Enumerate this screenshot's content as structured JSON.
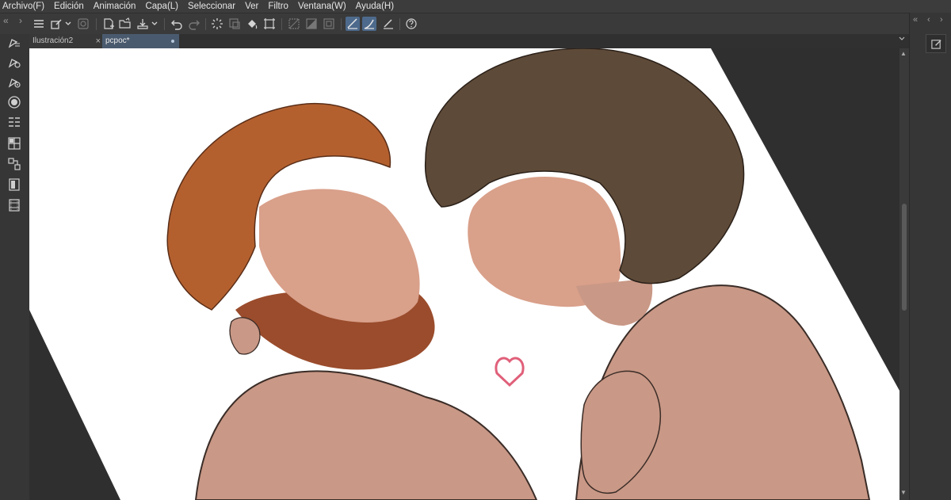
{
  "menu": [
    "Archivo(F)",
    "Edición",
    "Animación",
    "Capa(L)",
    "Seleccionar",
    "Ver",
    "Filtro",
    "Ventana(W)",
    "Ayuda(H)"
  ],
  "tabs": [
    {
      "label": "Ilustración2",
      "close": "×"
    },
    {
      "label": "pcpoc*"
    }
  ],
  "toolbar_icons": [
    "menu-icon",
    "layer-property-icon",
    "new-file-icon",
    "open-folder-icon",
    "save-icon",
    "undo-icon",
    "redo-icon",
    "loading-icon",
    "fill-icon",
    "transform-icon",
    "snap-ruler-icon",
    "snap-special-ruler-icon",
    "help-icon"
  ],
  "left_tools": [
    "pen-settings-icon",
    "brush-settings-icon",
    "sub-tool-icon",
    "circle-icon",
    "layer-list-icon",
    "grid-icon",
    "navigator-icon",
    "page-icon",
    "film-icon"
  ],
  "colors": {
    "chrome_bg": "#3c3c3c",
    "canvas_bg": "#2f2f2f",
    "active_tab": "#4a5a6e",
    "accent": "#4d6a8c"
  },
  "artwork": {
    "subject": "two figures illustration on rotated white canvas",
    "heart_color": "#e0607a"
  }
}
